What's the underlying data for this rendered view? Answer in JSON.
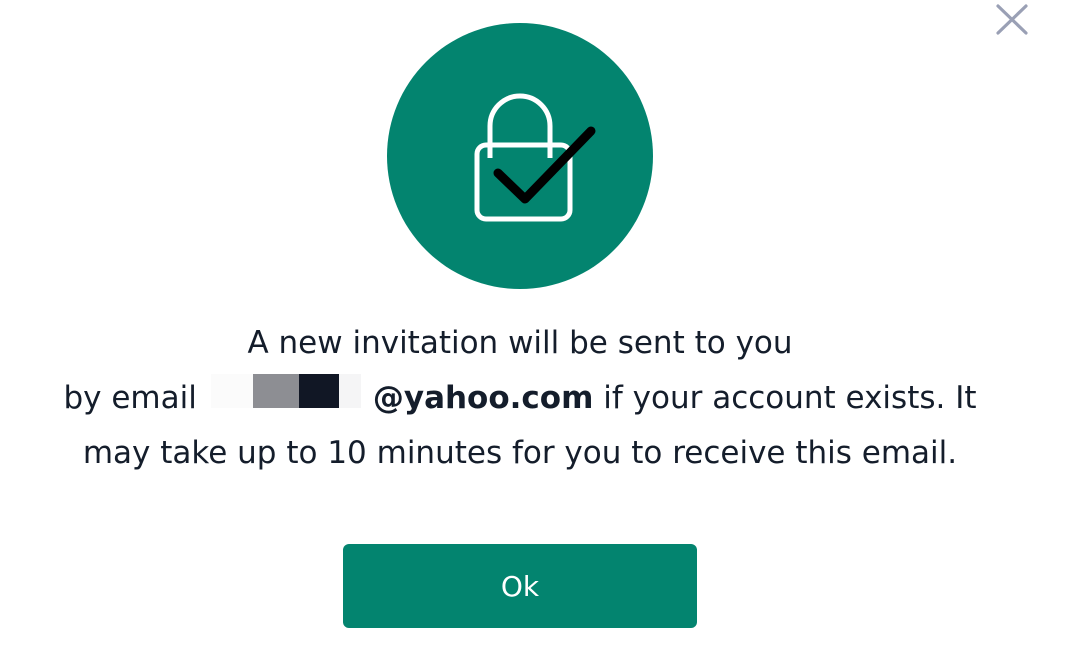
{
  "dialog": {
    "close_icon": "close-icon",
    "hero_icon": "lock-check-icon",
    "message": {
      "line1": "A new invitation will be sent to you",
      "line2_prefix": "by email",
      "email_domain": "@yahoo.com",
      "line2_suffix": " if your account exists. It",
      "line3": "may take up to 10 minutes for you to receive this email."
    },
    "ok_label": "Ok"
  },
  "colors": {
    "accent": "#03846f",
    "text": "#141d2b",
    "close_icon": "#9aa0b5",
    "background": "#ffffff"
  }
}
